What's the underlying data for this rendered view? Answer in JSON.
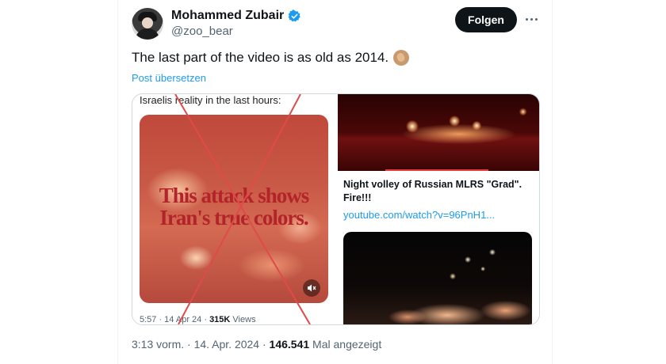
{
  "author": {
    "display_name": "Mohammed Zubair",
    "handle": "@zoo_bear",
    "verified_icon": "verified-badge-icon",
    "avatar_icon": "profile-avatar"
  },
  "actions": {
    "follow_label": "Folgen",
    "more_icon": "more-options-icon"
  },
  "tweet": {
    "text": "The last part of the video is as old as 2014.",
    "emoji_icon": "clapping-hands-icon",
    "translate_label": "Post übersetzen"
  },
  "media": {
    "left_video": {
      "caption": "Israelis reality in the last hours:",
      "overlay_text": "This attack shows Iran's true colors.",
      "meta_time": "5:57 · 14 Apr 24 ·",
      "meta_views": "315K",
      "meta_views_label": "Views",
      "speaker_icon": "speaker-icon",
      "crossed_out": true
    },
    "link_card": {
      "title": "Night volley of Russian MLRS \"Grad\". Fire!!!",
      "url": "youtube.com/watch?v=96PnH1..."
    }
  },
  "footer": {
    "timestamp": "3:13 vorm. · 14. Apr. 2024 ·",
    "views": "146.541",
    "views_label": "Mal angezeigt"
  },
  "colors": {
    "accent": "#1d9bf0",
    "follow_bg": "#0f1419",
    "cross_line": "#e04a4a",
    "text_secondary": "#536471"
  }
}
